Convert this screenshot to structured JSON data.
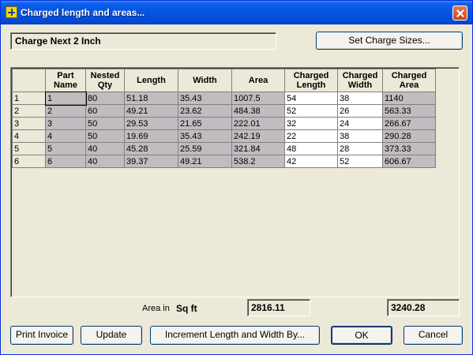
{
  "window": {
    "title": "Charged length and areas..."
  },
  "header": {
    "text": "Charge Next 2 Inch",
    "set_sizes_label": "Set Charge Sizes..."
  },
  "grid": {
    "columns": [
      "Part\nName",
      "Nested\nQty",
      "Length",
      "Width",
      "Area",
      "Charged\nLength",
      "Charged\nWidth",
      "Charged\nArea"
    ],
    "rows": [
      {
        "num": "1",
        "cells": [
          "1",
          "80",
          "51.18",
          "35.43",
          "1007.5",
          "54",
          "38",
          "1140"
        ]
      },
      {
        "num": "2",
        "cells": [
          "2",
          "60",
          "49.21",
          "23.62",
          "484.38",
          "52",
          "26",
          "563.33"
        ]
      },
      {
        "num": "3",
        "cells": [
          "3",
          "50",
          "29.53",
          "21.65",
          "222.01",
          "32",
          "24",
          "266.67"
        ]
      },
      {
        "num": "4",
        "cells": [
          "4",
          "50",
          "19.69",
          "35.43",
          "242.19",
          "22",
          "38",
          "290.28"
        ]
      },
      {
        "num": "5",
        "cells": [
          "5",
          "40",
          "45.28",
          "25.59",
          "321.84",
          "48",
          "28",
          "373.33"
        ]
      },
      {
        "num": "6",
        "cells": [
          "6",
          "40",
          "39.37",
          "49.21",
          "538.2",
          "42",
          "52",
          "606.67"
        ]
      }
    ]
  },
  "footer": {
    "area_in_label": "Area in",
    "unit": "Sq ft",
    "total_area": "2816.11",
    "total_charged_area": "3240.28"
  },
  "buttons": {
    "print_invoice": "Print Invoice",
    "update": "Update",
    "increment": "Increment Length and Width By...",
    "ok": "OK",
    "cancel": "Cancel"
  }
}
